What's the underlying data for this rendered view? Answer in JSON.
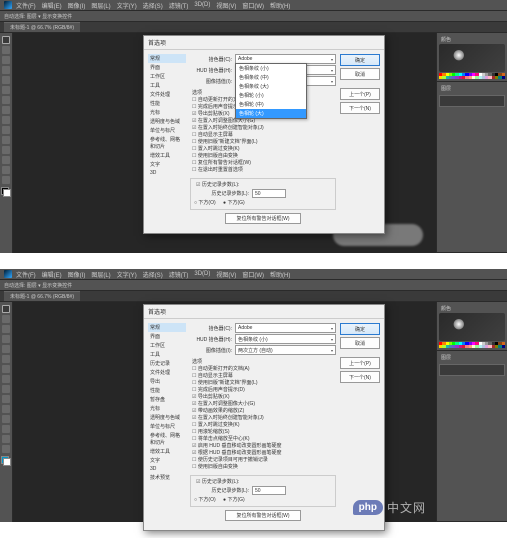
{
  "menu": {
    "items": [
      "文件(F)",
      "编辑(E)",
      "图像(I)",
      "图层(L)",
      "文字(Y)",
      "选择(S)",
      "滤镜(T)",
      "3D(D)",
      "视图(V)",
      "窗口(W)",
      "帮助(H)"
    ]
  },
  "options_bar": {
    "text": "自动选择:   图层 ▾   显示变换控件"
  },
  "tabs": {
    "doc": "未标题-1 @ 66.7% (RGB/8#)"
  },
  "dialog": {
    "title": "首选项",
    "categories": [
      "常规",
      "界面",
      "工作区",
      "工具",
      "历史记录",
      "文件处理",
      "导出",
      "性能",
      "暂存盘",
      "光标",
      "透明度与色域",
      "单位与标尺",
      "参考线、网格和切片",
      "增效工具",
      "文字",
      "3D",
      "技术预览"
    ],
    "selected_cat": 0,
    "fields": {
      "picker_label": "拾色器(C):",
      "picker_value": "Adobe",
      "hud_label": "HUD 拾色器(H):",
      "hud_value": "色相条纹 (小)",
      "interp_label": "图像插值(I):",
      "interp_value": "两次立方 (自动)"
    },
    "hud_dropdown1": {
      "open_at": 1,
      "options": [
        "色相条纹 (小)",
        "色相条纹 (中)",
        "色相条纹 (大)",
        "色相轮 (小)",
        "色相轮 (中)",
        "色相轮 (大)"
      ],
      "highlight": 5
    },
    "section_options": "选项",
    "checks_main_top": [
      {
        "t": "自动更新打开的文档(A)",
        "c": false
      },
      {
        "t": "完成后用声音提示(D)",
        "c": false
      },
      {
        "t": "导出剪贴板(X)",
        "c": true
      },
      {
        "t": "在置入时调整图像大小(G)",
        "c": true
      },
      {
        "t": "在置入时始终创建智能对象(J)",
        "c": true
      }
    ],
    "checks_main_bottom": [
      {
        "t": "自动显示主屏幕",
        "c": false
      },
      {
        "t": "使用旧版\"新建文档\"界面(L)",
        "c": false
      },
      {
        "t": "置入时跳过变换(K)",
        "c": false
      },
      {
        "t": "使用旧版自由变换",
        "c": false
      }
    ],
    "checks_variant_top": [
      {
        "t": "自动更新打开的文档(A)",
        "c": false
      },
      {
        "t": "自动显示主屏幕",
        "c": false
      },
      {
        "t": "使用旧版\"新建文档\"界面(L)",
        "c": false
      },
      {
        "t": "完成后用声音提示(D)",
        "c": false
      },
      {
        "t": "导出剪贴板(X)",
        "c": true
      },
      {
        "t": "在置入时调整图像大小(G)",
        "c": true
      },
      {
        "t": "带动画效果的缩放(Z)",
        "c": true
      },
      {
        "t": "在置入时始终创建智能对象(J)",
        "c": true
      },
      {
        "t": "置入时跳过变换(K)",
        "c": false
      },
      {
        "t": "用滚轮缩放(S)",
        "c": false
      },
      {
        "t": "将单击点缩放至中心(K)",
        "c": false
      },
      {
        "t": "启用 HUD 垂直移动改变圆形画笔硬度",
        "c": true
      },
      {
        "t": "根据 HUD 垂直移动改变圆形画笔硬度",
        "c": true
      },
      {
        "t": "使历史记录项目可用于撤销记录",
        "c": false
      },
      {
        "t": "使用旧版自由变换",
        "c": false
      }
    ],
    "reset_warnings": "复位所有警告对话框(W)",
    "reset_on_quit": "在退出时重置首选项",
    "history_group": {
      "label": "历史记录步数(L):",
      "value": "50",
      "radios_label": "暂存盘将在:",
      "r1": "下方(O)",
      "r2": "下方(G)"
    },
    "buttons": {
      "ok": "确定",
      "cancel": "取消",
      "prev": "上一个(P)",
      "next": "下一个(N)"
    }
  },
  "swatch_colors": [
    "#ff0000",
    "#ff8000",
    "#ffff00",
    "#80ff00",
    "#00ff00",
    "#00ff80",
    "#00ffff",
    "#0080ff",
    "#0000ff",
    "#8000ff",
    "#ff00ff",
    "#ff0080",
    "#ffffff",
    "#cccccc",
    "#999999",
    "#666666",
    "#333333",
    "#000000",
    "#8b4513",
    "#d2691e",
    "#ffd700",
    "#adff2f",
    "#20b2aa",
    "#4682b4",
    "#6a5acd",
    "#9932cc",
    "#c71585",
    "#dc143c",
    "#f08080",
    "#ffa07a",
    "#fafad2",
    "#98fb98",
    "#afeeee",
    "#b0c4de",
    "#dda0dd",
    "#ffb6c1",
    "#a52a2a",
    "#808000",
    "#008080",
    "#000080"
  ],
  "panels": {
    "color": "颜色",
    "layers": "图层"
  },
  "watermark": {
    "php": "php",
    "site": "中文网"
  }
}
